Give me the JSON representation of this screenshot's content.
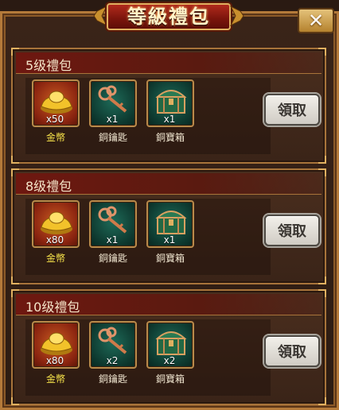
{
  "window": {
    "title": "等級禮包",
    "close_label": "✕"
  },
  "packs": [
    {
      "title": "5级禮包",
      "claim_label": "領取",
      "items": [
        {
          "name": "金幣",
          "qty": "x50",
          "icon": "gold-ingot-icon"
        },
        {
          "name": "銅鑰匙",
          "qty": "x1",
          "icon": "copper-key-icon"
        },
        {
          "name": "銅寶箱",
          "qty": "x1",
          "icon": "copper-chest-icon"
        }
      ]
    },
    {
      "title": "8级禮包",
      "claim_label": "領取",
      "items": [
        {
          "name": "金幣",
          "qty": "x80",
          "icon": "gold-ingot-icon"
        },
        {
          "name": "銅鑰匙",
          "qty": "x1",
          "icon": "copper-key-icon"
        },
        {
          "name": "銅寶箱",
          "qty": "x1",
          "icon": "copper-chest-icon"
        }
      ]
    },
    {
      "title": "10级禮包",
      "claim_label": "領取",
      "items": [
        {
          "name": "金幣",
          "qty": "x80",
          "icon": "gold-ingot-icon"
        },
        {
          "name": "銅鑰匙",
          "qty": "x2",
          "icon": "copper-key-icon"
        },
        {
          "name": "銅寶箱",
          "qty": "x2",
          "icon": "copper-chest-icon"
        }
      ]
    }
  ],
  "colors": {
    "panel_header": "#6e1810",
    "gold_item_name": "#f6e24a",
    "frame_border": "#b47a3a"
  }
}
